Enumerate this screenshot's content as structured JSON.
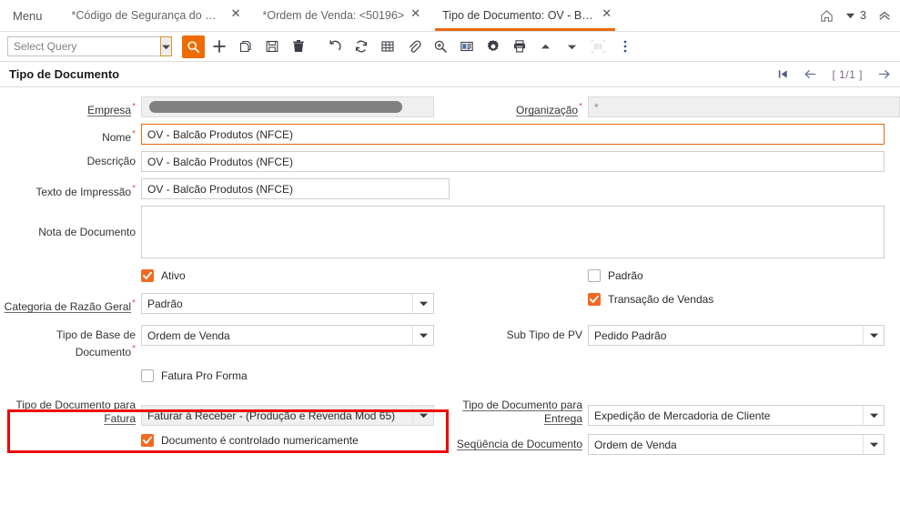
{
  "tabbar": {
    "menu_label": "Menu",
    "tabs": [
      {
        "label": "*Código de Segurança do Con...",
        "active": false
      },
      {
        "label": "*Ordem de Venda: <50196>",
        "active": false
      },
      {
        "label": "Tipo de Documento: OV - Bal...",
        "active": true
      }
    ],
    "close_glyph": "✕",
    "home_icon": "home-icon",
    "window_count": "3",
    "collapse_icon": "chevron-up-double-icon"
  },
  "toolbar": {
    "query_placeholder": "Select Query",
    "query_value": "",
    "buttons": [
      {
        "name": "search-button",
        "icon": "search-icon",
        "primary": true
      },
      {
        "name": "new-record-button",
        "icon": "plus-icon"
      },
      {
        "name": "copy-record-button",
        "icon": "copy-icon"
      },
      {
        "name": "save-button",
        "icon": "save-disk-icon"
      },
      {
        "name": "delete-button",
        "icon": "trash-icon"
      },
      {
        "name": "undo-button",
        "icon": "undo-icon"
      },
      {
        "name": "refresh-button",
        "icon": "refresh-icon"
      },
      {
        "name": "grid-toggle-button",
        "icon": "grid-icon"
      },
      {
        "name": "attachment-button",
        "icon": "paperclip-icon"
      },
      {
        "name": "zoom-button",
        "icon": "zoom-in-icon"
      },
      {
        "name": "record-info-button",
        "icon": "record-info-icon"
      },
      {
        "name": "preferences-button",
        "icon": "gear-icon"
      },
      {
        "name": "print-button",
        "icon": "printer-icon"
      },
      {
        "name": "parent-record-button",
        "icon": "triangle-up-icon"
      },
      {
        "name": "child-record-button",
        "icon": "triangle-down-icon"
      },
      {
        "name": "barcode-button",
        "icon": "barcode-icon",
        "disabled": true
      },
      {
        "name": "more-options-button",
        "icon": "kebab-menu-icon"
      }
    ]
  },
  "page": {
    "title": "Tipo de Documento",
    "nav": {
      "first_icon": "first-record-icon",
      "prev_icon": "prev-record-icon",
      "counter": "[ 1/1 ]",
      "next_icon": "next-record-icon"
    }
  },
  "form": {
    "empresa": {
      "label": "Empresa",
      "required": true,
      "value": "",
      "redacted": true
    },
    "organizacao": {
      "label": "Organização",
      "required": true,
      "value": "*"
    },
    "nome": {
      "label": "Nome",
      "required": true,
      "value": "OV - Balcão Produtos (NFCE)"
    },
    "descricao": {
      "label": "Descrição",
      "required": false,
      "value": "OV - Balcão Produtos (NFCE)"
    },
    "texto_impressao": {
      "label": "Texto de Impressão",
      "required": true,
      "value": "OV - Balcão Produtos (NFCE)"
    },
    "nota_documento": {
      "label": "Nota de Documento",
      "required": false,
      "value": ""
    },
    "ativo": {
      "label": "Ativo",
      "checked": true
    },
    "padrao": {
      "label": "Padrão",
      "checked": false
    },
    "categoria_razao_geral": {
      "label": "Categoria de Razão Geral",
      "required": true,
      "value": "Padrão"
    },
    "transacao_vendas": {
      "label": "Transação de Vendas",
      "checked": true
    },
    "tipo_base_documento": {
      "label": "Tipo de Base de Documento",
      "required": true,
      "value": "Ordem de Venda"
    },
    "sub_tipo_pv": {
      "label": "Sub Tipo de PV",
      "required": false,
      "value": "Pedido Padrão"
    },
    "fatura_pro_forma": {
      "label": "Fatura Pro Forma",
      "checked": false
    },
    "tipo_doc_fatura": {
      "label_line1": "Tipo de Documento para",
      "label_line2": "Fatura",
      "value": "Faturar à Receber - (Produção e Revenda Mod 65)",
      "highlighted": true
    },
    "tipo_doc_entrega": {
      "label_line1": "Tipo de Documento para",
      "label_line2": "Entrega",
      "value": "Expedição de Mercadoria de Cliente"
    },
    "doc_controlado": {
      "label": "Documento é controlado numericamente",
      "checked": true
    },
    "sequencia_documento": {
      "label": "Seqüência de Documento",
      "value": "Ordem de Venda"
    }
  },
  "colors": {
    "accent_orange": "#ef6c00",
    "checkbox_orange": "#f26a21",
    "highlight_red": "#ee0000",
    "focus_border": "#e8690b",
    "label_text": "#333333"
  }
}
